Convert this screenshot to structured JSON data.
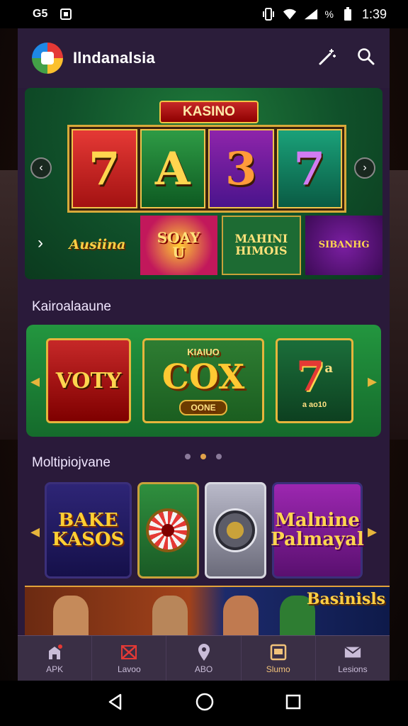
{
  "status_bar": {
    "left_badge_1": "G5",
    "time": "1:39",
    "battery_pct_glyph": "%"
  },
  "app": {
    "title": "Ilndanalsia"
  },
  "hero": {
    "title": "KASINO",
    "reels": [
      "7",
      "A",
      "3",
      "7"
    ],
    "tiles": [
      "Ausiina",
      "SOAY\nU",
      "MAHINI\nHIMOIS",
      "SIBANHG"
    ]
  },
  "section1": {
    "title": "Kairoalaaune",
    "tiles": {
      "left": "VOTY",
      "center": "COX",
      "center_top": "KIAIUO",
      "center_badge": "OONE",
      "right": "7",
      "right_small": "a",
      "right_sub": "a ao10"
    }
  },
  "section2": {
    "title": "Moltipiojvane",
    "cards": [
      "BAKE\nKASOS",
      "",
      "",
      "Malnine\nPalmayal"
    ]
  },
  "banner": {
    "text": "Basinisls"
  },
  "bottom_nav": [
    {
      "label": "APK",
      "icon": "shop-icon"
    },
    {
      "label": "Lavoo",
      "icon": "crossed-flag-icon"
    },
    {
      "label": "ABO",
      "icon": "map-pin-icon"
    },
    {
      "label": "Slumo",
      "icon": "slot-icon",
      "active": true
    },
    {
      "label": "Lesions",
      "icon": "envelope-icon"
    }
  ],
  "colors": {
    "accent_gold": "#e6b53c",
    "app_bg": "#2a1a3a",
    "felt_green": "#1f7a3a",
    "nav_active": "#f1c27a"
  },
  "carousel": {
    "dots": 3,
    "active_dot": 2
  }
}
